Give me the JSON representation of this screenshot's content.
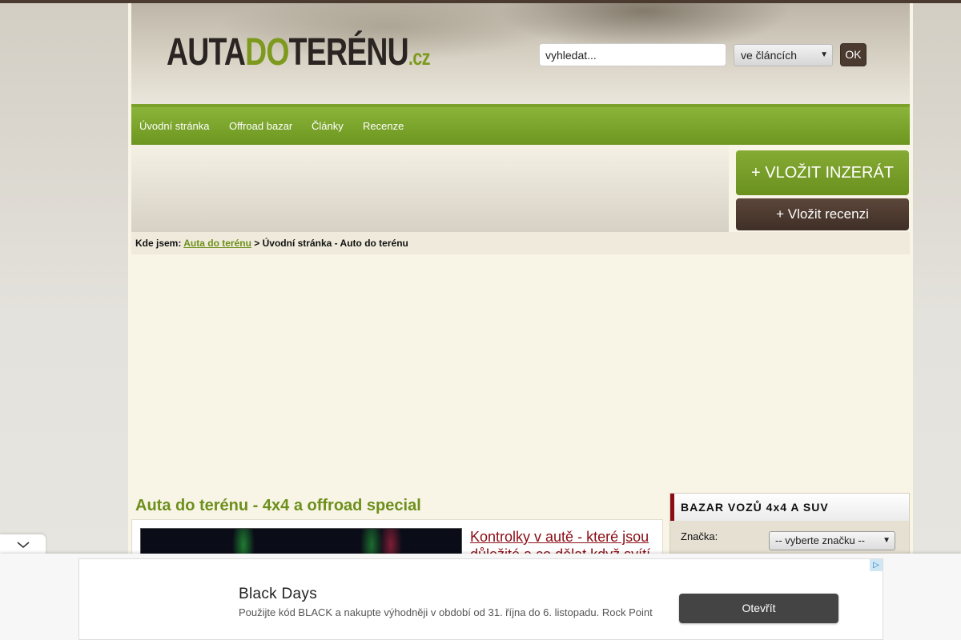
{
  "header": {
    "logo_part1": "AUTA",
    "logo_part2": "DO",
    "logo_part3": "TERÉNU",
    "logo_tld": ".cz",
    "search_value": "vyhledat...",
    "search_scope": "ve článcích",
    "search_button": "OK"
  },
  "nav": {
    "items": [
      {
        "label": "Úvodní stránka"
      },
      {
        "label": "Offroad bazar"
      },
      {
        "label": "Články"
      },
      {
        "label": "Recenze"
      }
    ]
  },
  "actions": {
    "insert_ad": "+ VLOŽIT INZERÁT",
    "insert_review": "+ Vložit recenzi"
  },
  "breadcrumb": {
    "prefix": "Kde jsem:",
    "link": "Auta do terénu",
    "separator": ">",
    "current": "Úvodní stránka - Auto do terénu"
  },
  "main": {
    "section_title": "Auta do terénu - 4x4 a offroad special",
    "article_title": "Kontrolky v autě - které jsou důležité a co dělat když svítí"
  },
  "sidebar": {
    "bazar_title": "BAZAR VOZŮ 4x4 A SUV",
    "brand_label": "Značka:",
    "brand_select": "-- vyberte značku --"
  },
  "ad_overlay": {
    "title": "Black Days",
    "text": "Použijte kód BLACK a nakupte výhodněji v období od 31. října do 6. listopadu. Rock Point",
    "cta": "Otevřít"
  },
  "colors": {
    "brand_green": "#7d9a1f",
    "brand_brown": "#4a3a30",
    "accent_red": "#8a0d14"
  }
}
